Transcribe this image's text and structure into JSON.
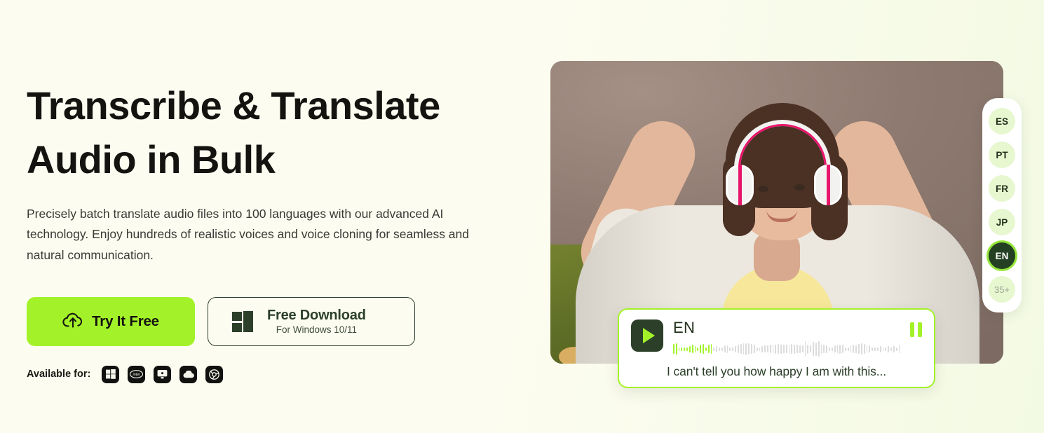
{
  "hero": {
    "headline_line1": "Transcribe & Translate",
    "headline_line2": "Audio in Bulk",
    "subtext": "Precisely batch translate audio files into 100 languages with our advanced AI technology. Enjoy hundreds of realistic voices and voice cloning for seamless and natural communication."
  },
  "cta": {
    "try_label": "Try It Free",
    "try_icon": "cloud-upload-icon",
    "download_label": "Free Download",
    "download_sub": "For Windows 10/11",
    "download_icon": "windows-logo-icon"
  },
  "availability": {
    "label": "Available for:",
    "platforms": [
      {
        "name": "windows-icon",
        "title": "Windows"
      },
      {
        "name": "intel-icon",
        "title": "Intel"
      },
      {
        "name": "monitor-icon",
        "title": "Desktop"
      },
      {
        "name": "cloud-icon",
        "title": "Cloud"
      },
      {
        "name": "chrome-icon",
        "title": "Chrome"
      }
    ]
  },
  "language_panel": {
    "chips": [
      {
        "code": "ES",
        "active": false
      },
      {
        "code": "PT",
        "active": false
      },
      {
        "code": "FR",
        "active": false
      },
      {
        "code": "JP",
        "active": false
      },
      {
        "code": "EN",
        "active": true
      },
      {
        "code": "35+",
        "active": false
      }
    ]
  },
  "player": {
    "language": "EN",
    "caption": "I can't tell you how happy I am with this...",
    "play_icon": "play-icon",
    "pause_icon": "pause-icon",
    "waveform": {
      "played_bars": 15,
      "heights": [
        14,
        16,
        5,
        5,
        5,
        5,
        9,
        12,
        9,
        5,
        12,
        14,
        5,
        12,
        14,
        5,
        9,
        5,
        5,
        10,
        11,
        5,
        5,
        9,
        12,
        14,
        16,
        17,
        16,
        14,
        12,
        5,
        5,
        9,
        10,
        10,
        12,
        12,
        13,
        14,
        13,
        12,
        12,
        13,
        14,
        13,
        12,
        11,
        10,
        22,
        13,
        10,
        20,
        19,
        22,
        13,
        12,
        11,
        5,
        5,
        10,
        12,
        13,
        12,
        5,
        5,
        10,
        12,
        11,
        14,
        16,
        14,
        11,
        10,
        5,
        5,
        5,
        9,
        5,
        5,
        9,
        5,
        9,
        5,
        12
      ]
    }
  },
  "colors": {
    "accent_lime": "#a3f229",
    "dark_green": "#2c4029",
    "chip_bg": "#e7f7cf",
    "page_bg": "#fdfcf1",
    "page_bg_right": "#f3fae3"
  }
}
